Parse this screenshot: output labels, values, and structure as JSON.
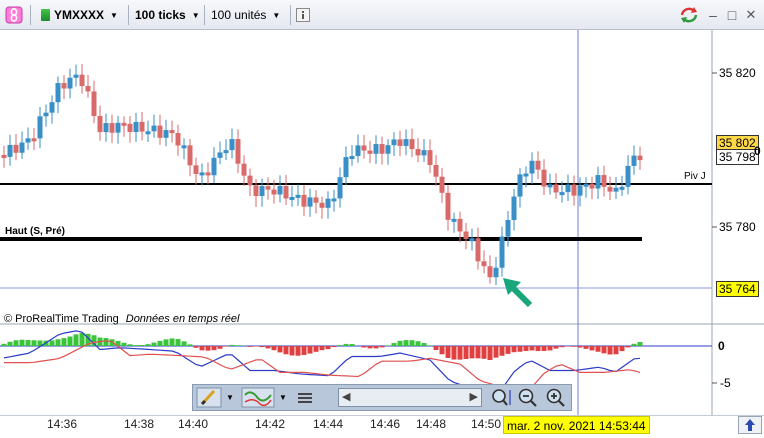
{
  "toolbar": {
    "symbol": "YMXXXX",
    "period": "100 ticks",
    "units": "100 unités",
    "info_icon": "info-icon",
    "link_icon": "chain-link-icon",
    "refresh_icon": "refresh-arrows-icon"
  },
  "window": {
    "minimize": "–",
    "maximize": "□",
    "close": "✕"
  },
  "price_panel": {
    "y_labels": [
      "35 820",
      "35 780"
    ],
    "current_price_high": "35 802",
    "current_price": "35 798",
    "cursor_price": "35 764",
    "zero_marker": "0",
    "pivot_label": "Piv J",
    "high_label": "Haut (S, Pré)",
    "watermark": "© ProRealTime Trading",
    "realtime_label": "Données en temps réel"
  },
  "indicator_panel": {
    "zero_label": "0",
    "minus5_label": "-5"
  },
  "x_axis": {
    "labels": [
      "14:36",
      "14:38",
      "14:40",
      "14:42",
      "14:44",
      "14:46",
      "14:48",
      "14:50"
    ],
    "cursor_datetime": "mar. 2 nov. 2021 14:53:44"
  },
  "colors": {
    "up_candle": "#3a8fc7",
    "down_candle": "#d96a6a",
    "histogram_up": "#3ac43a",
    "histogram_down": "#e04040",
    "macd_line": "#2a3cc8",
    "signal_line": "#e05050",
    "price_box": "#ffd84a",
    "cursor_box": "#ffff00",
    "arrow": "#18a67a"
  }
}
